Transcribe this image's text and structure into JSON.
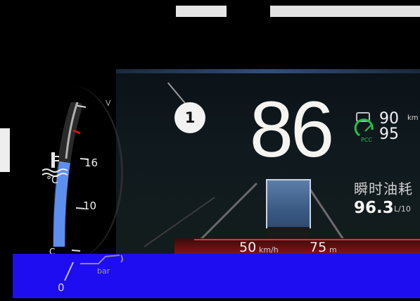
{
  "cluster": {
    "speed": "86",
    "limits": {
      "upper": "90",
      "lower": "95",
      "unit": "km",
      "cruise_badge": "PCC"
    },
    "fuel": {
      "label": "瞬时油耗",
      "value": "96.3",
      "unit": "L/10"
    },
    "distance_bar": {
      "speed": "50",
      "speed_unit": "km/h",
      "gap": "75",
      "gap_unit": "m"
    },
    "callout": "1",
    "coolant_gauge": {
      "ticks": [
        "16",
        "10"
      ],
      "top_mark": "V",
      "bottom_mark": "C",
      "unit": "°C",
      "fill_fraction": 0.6,
      "accent": "#5c8ff0"
    },
    "oil_gauge": {
      "unit": "bar",
      "zero": "0"
    },
    "colors": {
      "background": "#000000",
      "speed": "#f4f4f0",
      "alert_bar": "#8a1414",
      "overlay": "#1f0df2"
    }
  }
}
